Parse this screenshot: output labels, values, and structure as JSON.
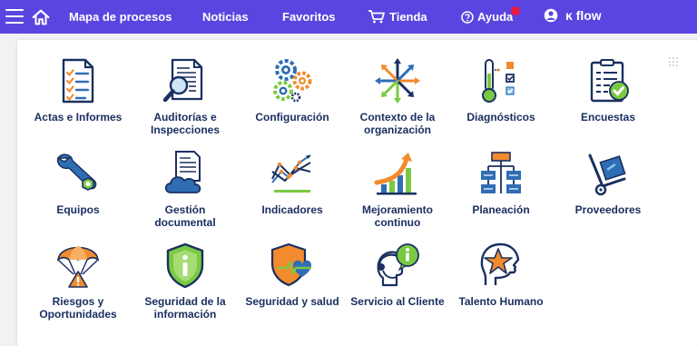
{
  "nav": {
    "menu_icon": "hamburger-icon",
    "home_icon": "home-icon",
    "items": [
      {
        "label": "Mapa de procesos"
      },
      {
        "label": "Noticias"
      },
      {
        "label": "Favoritos"
      },
      {
        "label": "Tienda",
        "icon": "cart-icon"
      },
      {
        "label": "Ayuda",
        "icon": "help-circle-icon",
        "badge_color": "#e8193c"
      }
    ],
    "brand": "ĸ flow",
    "brand_icon": "user-group-icon"
  },
  "colors": {
    "topbar": "#5b45e0",
    "label": "#1a3060",
    "accent_green": "#7ac943",
    "accent_orange": "#f28a2e",
    "accent_blue": "#2f6db5"
  },
  "grid_icon": "drag-grid-icon",
  "modules": [
    {
      "label": "Actas e Informes",
      "icon": "checklist-document-icon"
    },
    {
      "label": "Auditorías e Inspecciones",
      "icon": "magnifier-document-icon"
    },
    {
      "label": "Configuración",
      "icon": "gears-icon"
    },
    {
      "label": "Contexto de la organización",
      "icon": "arrows-compass-icon"
    },
    {
      "label": "Diagnósticos",
      "icon": "thermometer-checklist-icon"
    },
    {
      "label": "Encuestas",
      "icon": "clipboard-check-icon"
    },
    {
      "label": "Equipos",
      "icon": "wrench-icon"
    },
    {
      "label": "Gestión documental",
      "icon": "document-cloud-icon"
    },
    {
      "label": "Indicadores",
      "icon": "trend-lines-icon"
    },
    {
      "label": "Mejoramiento continuo",
      "icon": "growth-bars-icon"
    },
    {
      "label": "Planeación",
      "icon": "org-chart-icon"
    },
    {
      "label": "Proveedores",
      "icon": "hand-truck-icon"
    },
    {
      "label": "Riesgos y Oportunidades",
      "icon": "parachute-warning-icon"
    },
    {
      "label": "Seguridad de la información",
      "icon": "shield-info-icon"
    },
    {
      "label": "Seguridad y salud",
      "icon": "shield-heartbeat-icon"
    },
    {
      "label": "Servicio al Cliente",
      "icon": "head-headset-icon"
    },
    {
      "label": "Talento Humano",
      "icon": "head-star-icon"
    }
  ]
}
